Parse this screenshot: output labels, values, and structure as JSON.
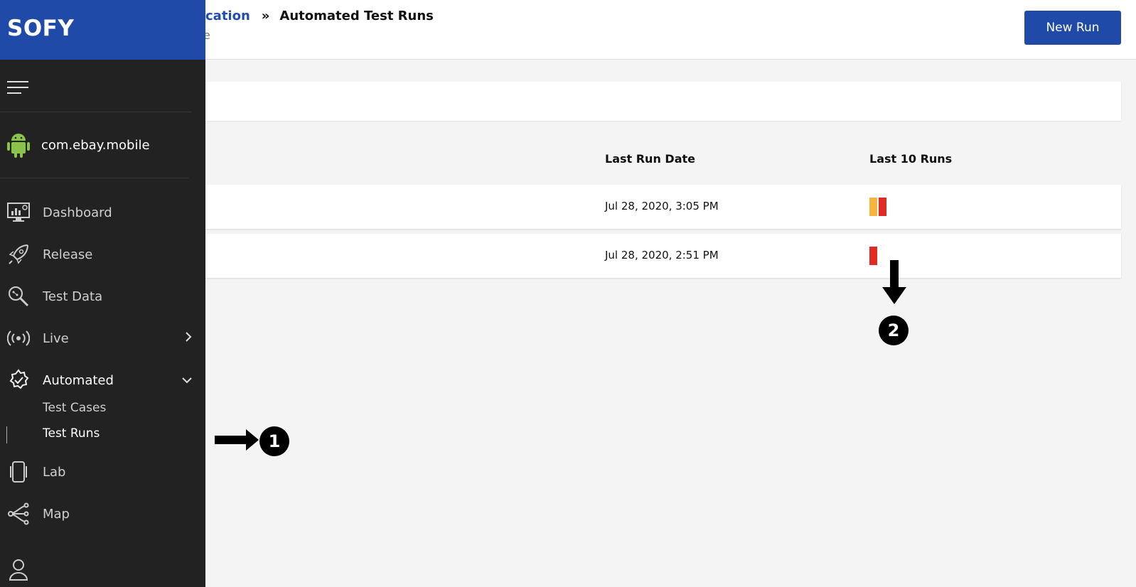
{
  "header": {
    "breadcrumb_link": "cation",
    "breadcrumb_sep": "»",
    "breadcrumb_current": "Automated Test Runs",
    "sub_crumb": "e",
    "new_run_label": "New Run"
  },
  "sidebar": {
    "logo": "SOFY",
    "app_name": "com.ebay.mobile",
    "items": [
      {
        "label": "Dashboard",
        "icon": "dashboard-icon"
      },
      {
        "label": "Release",
        "icon": "rocket-icon"
      },
      {
        "label": "Test Data",
        "icon": "test-data-icon"
      },
      {
        "label": "Live",
        "icon": "broadcast-icon"
      },
      {
        "label": "Automated",
        "icon": "gear-check-icon"
      },
      {
        "label": "Lab",
        "icon": "phone-icon"
      },
      {
        "label": "Map",
        "icon": "map-icon"
      }
    ],
    "sub_items": [
      {
        "label": "Test Cases"
      },
      {
        "label": "Test Runs"
      }
    ]
  },
  "table": {
    "columns": [
      "Last Run Date",
      "Last 10 Runs"
    ],
    "rows": [
      {
        "last_run_date": "Jul 28, 2020, 3:05 PM",
        "runs": [
          "#f3b53d",
          "#e02a24"
        ]
      },
      {
        "last_run_date": "Jul 28, 2020, 2:51 PM",
        "runs": [
          "#e02a24"
        ]
      }
    ]
  },
  "annotations": [
    "1",
    "2"
  ],
  "colors": {
    "brand": "#1f4aa8",
    "sidebar_bg": "#222222",
    "run_warning": "#f3b53d",
    "run_failed": "#e02a24"
  }
}
